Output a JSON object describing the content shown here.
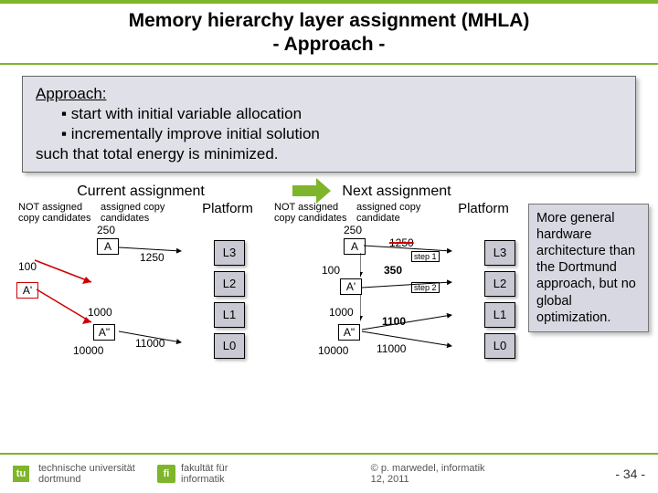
{
  "title_line1": "Memory hierarchy layer assignment (MHLA)",
  "title_line2": "- Approach -",
  "approach": {
    "heading": "Approach:",
    "bullet1": "start with initial variable allocation",
    "bullet2": "incrementally improve initial solution",
    "tail": "such that total energy is minimized."
  },
  "left": {
    "label": "Current assignment",
    "col1": "NOT assigned copy candidates",
    "col2": "assigned copy candidates",
    "col3": "Platform",
    "n250": "250",
    "A": "A",
    "n100": "100",
    "n1250": "1250",
    "Aprime": "A'",
    "n1000": "1000",
    "Adbl": "A\"",
    "n10000": "10000",
    "n11000": "11000",
    "L3": "L3",
    "L2": "L2",
    "L1": "L1",
    "L0": "L0"
  },
  "right": {
    "label": "Next assignment",
    "col1": "NOT assigned copy candidates",
    "col2": "assigned copy candidate",
    "col3": "Platform",
    "n250": "250",
    "A": "A",
    "strike1250": "1250",
    "n100": "100",
    "n350": "350",
    "step1": "step 1",
    "Aprime": "A'",
    "step2": "step 2",
    "n1000": "1000",
    "n1100": "1100",
    "Adbl": "A\"",
    "n10000": "10000",
    "n11000": "11000",
    "L3": "L3",
    "L2": "L2",
    "L1": "L1",
    "L0": "L0"
  },
  "sidenote": "More general hardware architecture than the Dortmund approach, but no global optimization.",
  "footer": {
    "tu": "technische universität dortmund",
    "fi": "fakultät für informatik",
    "credit": "© p. marwedel, informatik 12, 2011",
    "page": "- 34 -"
  }
}
